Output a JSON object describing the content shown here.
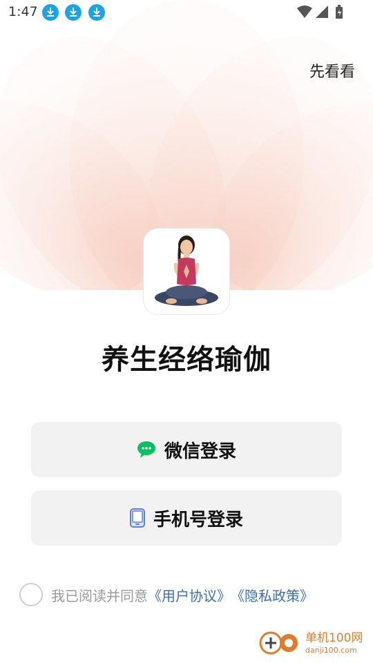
{
  "status_bar": {
    "time": "1:47",
    "notification_icons": [
      "download-icon",
      "download-icon",
      "download-icon"
    ],
    "system_icons": [
      "wifi-icon",
      "signal-icon",
      "battery-charging-icon"
    ]
  },
  "header": {
    "skip_label": "先看看"
  },
  "app": {
    "title": "养生经络瑜伽",
    "logo_icon": "yoga-meditation-logo"
  },
  "login": {
    "wechat_label": "微信登录",
    "wechat_icon": "wechat-icon",
    "phone_label": "手机号登录",
    "phone_icon": "phone-icon"
  },
  "agreement": {
    "prefix": "我已阅读并同意",
    "user_agreement": "《用户协议》",
    "privacy_policy": "《隐私政策》"
  },
  "watermark": {
    "name": "单机100网",
    "domain": "danji100.com"
  },
  "colors": {
    "accent_link": "#3c6fb5",
    "wechat_green": "#07c160",
    "phone_blue": "#5b7fe0",
    "lotus_tint": "#f6c7b8"
  }
}
